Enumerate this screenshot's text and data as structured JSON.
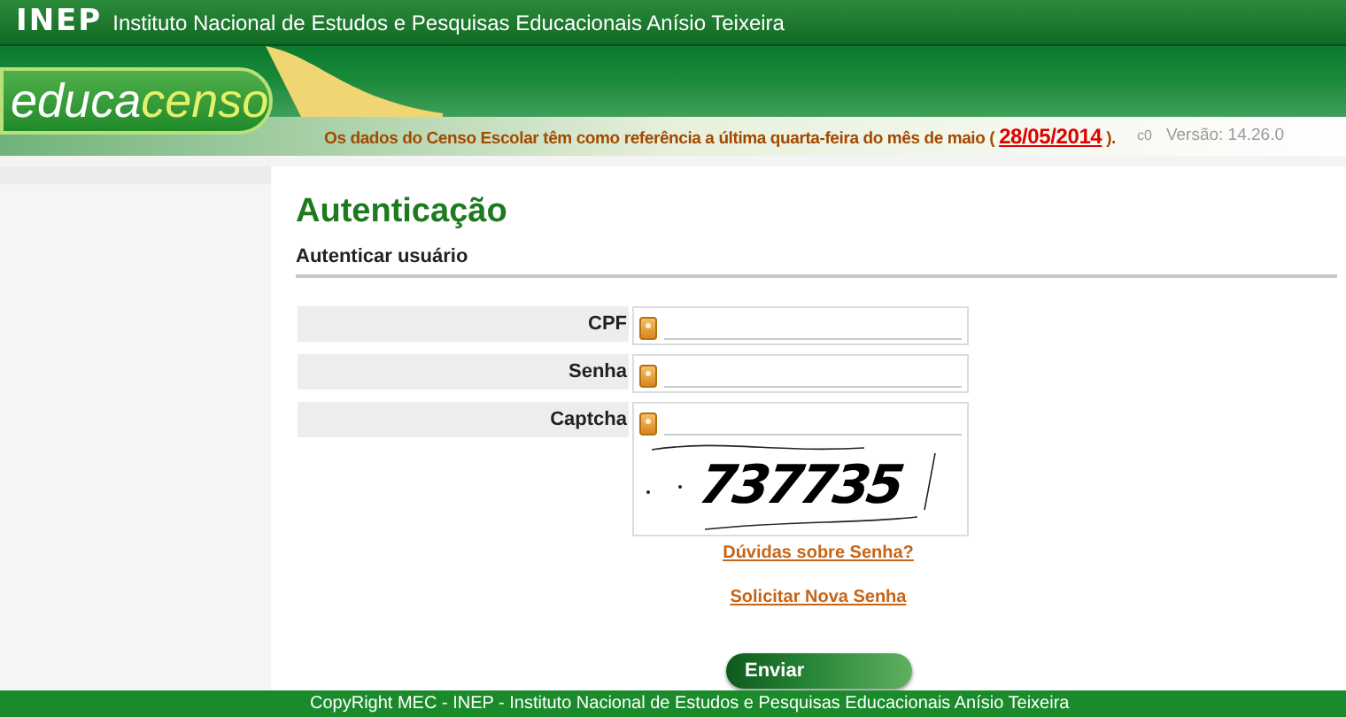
{
  "top_bar": {
    "logo": "INEP",
    "title": "Instituto Nacional de Estudos e Pesquisas Educacionais Anísio Teixeira"
  },
  "header": {
    "logo": {
      "prefix": "e",
      "middle": "duca",
      "suffix": "censo"
    },
    "notice": "Os dados do Censo Escolar têm como referência a última quarta-feira do mês de maio (",
    "notice_date": "28/05/2014",
    "notice_end": ").",
    "code": "c0",
    "version": "Versão: 14.26.0"
  },
  "page": {
    "title": "Autenticação",
    "subtitle": "Autenticar usuário"
  },
  "form": {
    "fields": [
      {
        "label": "CPF",
        "kind": "text"
      },
      {
        "label": "Senha",
        "kind": "password"
      },
      {
        "label": "Captcha",
        "kind": "captcha",
        "captcha_text": "737735"
      }
    ],
    "links": [
      "Dúvidas sobre Senha?",
      "Solicitar Nova Senha"
    ],
    "submit": "Enviar"
  },
  "footer": "CopyRight MEC - INEP - Instituto Nacional de Estudos e Pesquisas Educacionais Anísio Teixeira"
}
